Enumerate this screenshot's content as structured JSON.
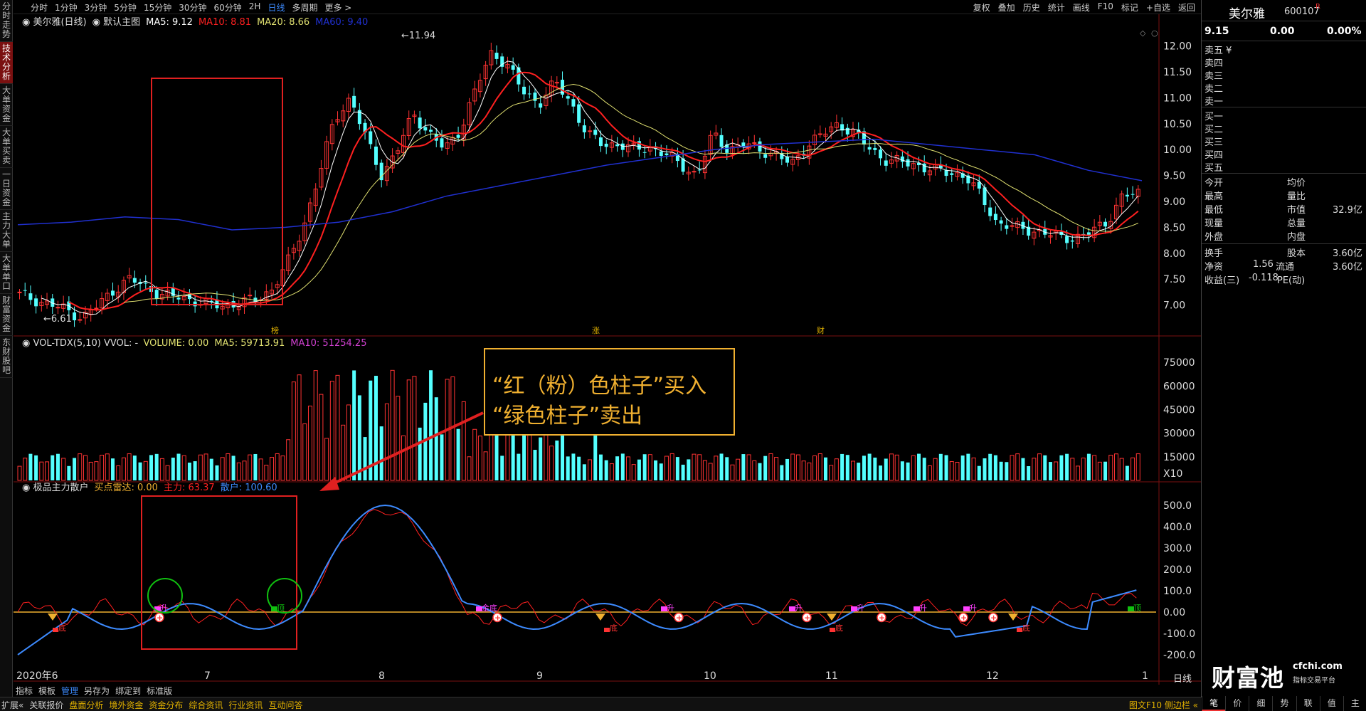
{
  "left_tabs": [
    "分时走势",
    "技术分析",
    "大单资金",
    "大单买卖",
    "一日资金",
    "主力大单",
    "大单单口",
    "财富资金",
    "东财股吧"
  ],
  "left_tab_active": 1,
  "periods": [
    "分时",
    "1分钟",
    "3分钟",
    "5分钟",
    "15分钟",
    "30分钟",
    "60分钟",
    "2H",
    "日线",
    "多周期",
    "更多 >"
  ],
  "period_active": 8,
  "tools": [
    "复权",
    "叠加",
    "历史",
    "统计",
    "画线",
    "F10",
    "标记",
    "+自选",
    "返回"
  ],
  "main_legend": {
    "stock": "美尔雅(日线)",
    "template": "默认主图",
    "ma5": "MA5: 9.12",
    "ma10": "MA10: 8.81",
    "ma20": "MA20: 8.66",
    "ma60": "MA60: 9.40"
  },
  "vol_legend": {
    "name": "VOL-TDX(5,10) VVOL: -",
    "volume": "VOLUME: 0.00",
    "ma5": "MA5: 59713.91",
    "ma10": "MA10: 51254.25"
  },
  "ind_legend": {
    "name": "极品主力散户",
    "radar": "买点雷达: 0.00",
    "main": "主力: 63.37",
    "retail": "散户: 100.60"
  },
  "price_labels": [
    "12.00",
    "11.50",
    "11.00",
    "10.50",
    "10.00",
    "9.50",
    "9.00",
    "8.50",
    "8.00",
    "7.50",
    "7.00"
  ],
  "price_ticks": [
    12.0,
    11.5,
    11.0,
    10.5,
    10.0,
    9.5,
    9.0,
    8.5,
    8.0,
    7.5,
    7.0
  ],
  "vol_labels": [
    "75000",
    "60000",
    "45000",
    "30000",
    "15000",
    "X10"
  ],
  "vol_ticks": [
    75000,
    60000,
    45000,
    30000,
    15000
  ],
  "ind_labels": [
    "500.0",
    "400.0",
    "300.0",
    "200.0",
    "100.0",
    "0.00",
    "-100.0",
    "-200.0"
  ],
  "ind_ticks": [
    500,
    400,
    300,
    200,
    100,
    0,
    -100,
    -200
  ],
  "x_labels": [
    "2020年6",
    "7",
    "8",
    "9",
    "10",
    "11",
    "12",
    "1"
  ],
  "high_mark": "11.94",
  "low_mark": "6.61",
  "event_marks": [
    "榜",
    "涨",
    "财"
  ],
  "ind_marks": {
    "rise": "升",
    "bottom": "底",
    "top": "顶",
    "golden_bottom": "金底"
  },
  "annotation": {
    "line1": "“红（粉）色柱子”买入",
    "line2": "“绿色柱子”卖出"
  },
  "quote": {
    "name": "美尔雅",
    "code": "600107",
    "r": "R",
    "price": "9.15",
    "change": "0.00",
    "pct": "0.00%",
    "sells": [
      "卖五 ¥",
      "卖四",
      "卖三",
      "卖二",
      "卖一"
    ],
    "buys": [
      "买一",
      "买二",
      "买三",
      "买四",
      "买五"
    ],
    "stats_left": [
      "今开",
      "最高",
      "最低",
      "现量",
      "外盘"
    ],
    "stats_right": [
      "均价",
      "量比",
      "市值",
      "总量",
      "内盘"
    ],
    "mkt_cap": "32.9亿",
    "turnover_label": "换手",
    "share_label": "股本",
    "share": "3.60亿",
    "nav_label": "净资",
    "nav": "1.56",
    "float_label": "流通",
    "float": "3.60亿",
    "eps_label": "收益(三)",
    "eps": "-0.118",
    "pe_label": "PE(动)"
  },
  "logo": {
    "main": "财富池",
    "domain": "cfchi.com",
    "sub": "指标交易平台"
  },
  "right_tabs": [
    "笔",
    "价",
    "细",
    "势",
    "联",
    "值",
    "主"
  ],
  "right_tab_active": 0,
  "ind_tabs": [
    "指标",
    "模板",
    "管理",
    "另存为",
    "绑定到",
    "标准版"
  ],
  "ind_tab_active": 2,
  "period_footer": "日线",
  "status_items": [
    "扩展«",
    "关联报价",
    "盘面分析",
    "境外资金",
    "资金分布",
    "综合资讯",
    "行业资讯",
    "互动问答"
  ],
  "status_right": "图文F10 侧边栏 «",
  "colors": {
    "up": "#ff3333",
    "down": "#54ffff",
    "ma5": "#ffffff",
    "ma10": "#ff2020",
    "ma20": "#e0e070",
    "ma60": "#2030d0",
    "orange": "#f0b030",
    "box": "#e02020",
    "circle": "#10c010"
  },
  "chart_data": {
    "type": "candlestick",
    "period": "daily",
    "x_months": [
      "2020-06",
      "2020-07",
      "2020-08",
      "2020-09",
      "2020-10",
      "2020-11",
      "2020-12",
      "2021-01"
    ],
    "price_range": [
      6.5,
      12.2
    ],
    "price_points": [
      7.2,
      7.1,
      7.0,
      6.9,
      6.75,
      7.0,
      7.3,
      7.5,
      7.35,
      7.2,
      7.15,
      7.1,
      7.0,
      6.98,
      7.05,
      7.1,
      7.3,
      7.8,
      8.5,
      9.5,
      10.6,
      11.0,
      10.2,
      9.5,
      10.0,
      10.7,
      10.3,
      10.0,
      10.4,
      11.2,
      11.9,
      11.6,
      11.1,
      10.9,
      11.3,
      10.9,
      10.3,
      10.1,
      10.1,
      10.0,
      10.05,
      9.9,
      9.7,
      9.5,
      10.3,
      10.0,
      10.1,
      10.0,
      9.9,
      9.7,
      10.1,
      10.3,
      10.5,
      10.3,
      10.0,
      9.8,
      9.75,
      9.7,
      9.6,
      9.55,
      9.5,
      9.1,
      8.6,
      8.5,
      8.45,
      8.4,
      8.3,
      8.3,
      8.4,
      8.6,
      9.1,
      9.15
    ],
    "ma60_points": [
      8.55,
      8.6,
      8.7,
      8.65,
      8.45,
      8.5,
      8.6,
      8.8,
      9.1,
      9.3,
      9.5,
      9.7,
      9.85,
      10.0,
      10.1,
      10.15,
      10.2,
      10.1,
      10.0,
      9.9,
      9.6,
      9.4
    ],
    "volume_range": [
      0,
      80000
    ],
    "indicator_range": [
      -300,
      560
    ],
    "main_force_peak": 500,
    "retail_last": 100.6,
    "main_last": 63.37
  }
}
